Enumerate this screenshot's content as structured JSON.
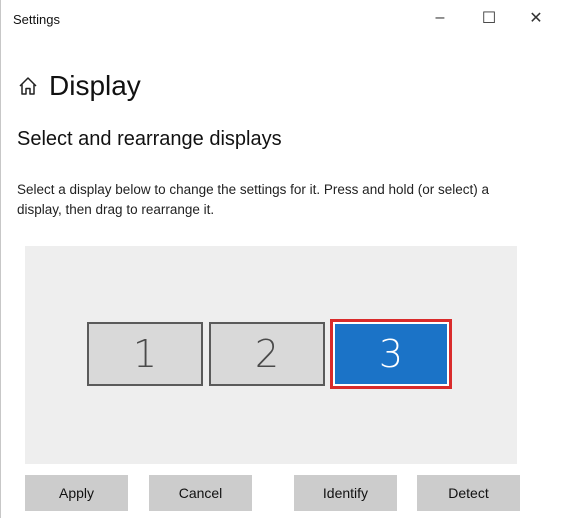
{
  "window": {
    "title": "Settings",
    "minimize": "–",
    "maximize": "☐",
    "close": "✕"
  },
  "page": {
    "title": "Display",
    "home_icon": "home-icon"
  },
  "section": {
    "heading": "Select and rearrange displays",
    "description": "Select a display below to change the settings for it. Press and hold (or select) a display, then drag to rearrange it."
  },
  "displays": [
    {
      "label": "1",
      "selected": false
    },
    {
      "label": "2",
      "selected": false
    },
    {
      "label": "3",
      "selected": true
    }
  ],
  "buttons": {
    "apply": "Apply",
    "cancel": "Cancel",
    "identify": "Identify",
    "detect": "Detect"
  },
  "colors": {
    "selected_display": "#1b73c7",
    "unselected_display": "#d9d9d9",
    "highlight_outline": "#d92b2b",
    "arrange_background": "#eeeeee",
    "button_background": "#cccccc"
  }
}
